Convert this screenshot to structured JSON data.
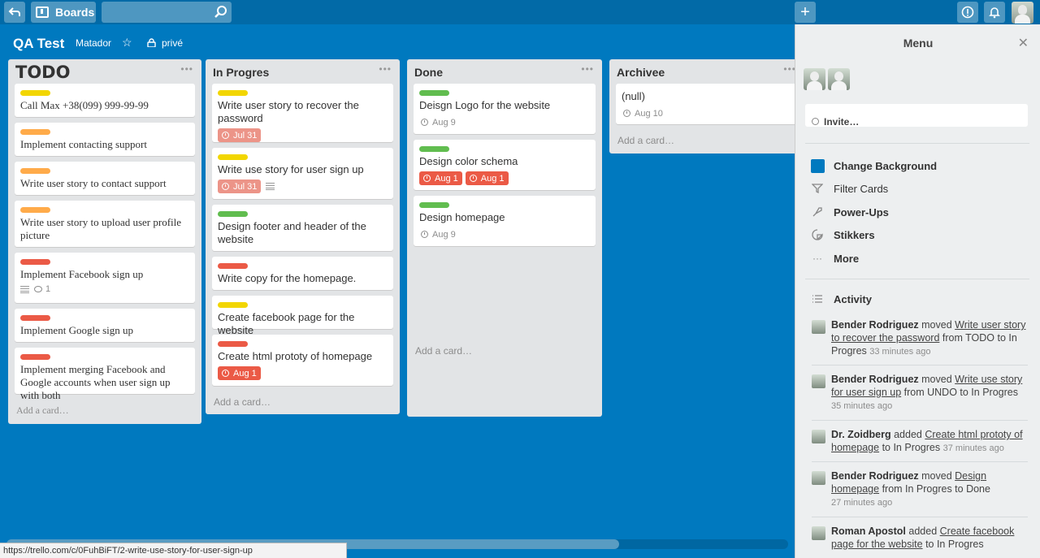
{
  "topbar": {
    "boards_label": "Boards",
    "search_placeholder": "",
    "plus": "+"
  },
  "board": {
    "title": "QA Test",
    "team": "Matador",
    "privacy": "privé"
  },
  "lists": [
    {
      "title": "TODO",
      "add_card": "Add a card…",
      "cards": [
        {
          "label_color": "#f2d600",
          "title": "Call Max +38(099) 999-99-99"
        },
        {
          "label_color": "#ffab4a",
          "title": "Implement contacting support"
        },
        {
          "label_color": "#ffab4a",
          "title": "Write user story to contact support"
        },
        {
          "label_color": "#ffab4a",
          "title": "Write user story to upload user profile picture"
        },
        {
          "label_color": "#eb5a46",
          "title": "Implement Facebook sign up",
          "comments": "1"
        },
        {
          "label_color": "#eb5a46",
          "title": "Implement Google sign up"
        },
        {
          "label_color": "#eb5a46",
          "title": "Implement merging Facebook and Google accounts when user sign up with both"
        }
      ]
    },
    {
      "title": "In Progres",
      "add_card": "Add a card…",
      "cards": [
        {
          "label_color": "#f2d600",
          "title": "Write user story to recover the password",
          "due": "Jul 31"
        },
        {
          "label_color": "#f2d600",
          "title": "Write use story for user sign up",
          "due": "Jul 31"
        },
        {
          "label_color": "#61bd4f",
          "title": "Design footer and header of the website"
        },
        {
          "label_color": "#eb5a46",
          "title": "Write copy for the homepage."
        },
        {
          "label_color": "#f2d600",
          "title": "Create facebook page for the website"
        },
        {
          "label_color": "#eb5a46",
          "title": "Create html prototy of homepage",
          "due": "Aug 1"
        }
      ]
    },
    {
      "title": "Done",
      "add_card": "Add a card…",
      "cards": [
        {
          "label_color": "#61bd4f",
          "title": "Deisgn Logo for the website",
          "due": "Aug 9"
        },
        {
          "label_color": "#61bd4f",
          "title": "Design color schema",
          "due": "Aug 1",
          "due2": "Aug 1"
        },
        {
          "label_color": "#61bd4f",
          "title": "Design homepage",
          "due": "Aug 9"
        }
      ]
    },
    {
      "title": "Archivee",
      "add_card": "Add a card…",
      "cards": [
        {
          "title": "(null)",
          "due": "Aug 10"
        }
      ]
    }
  ],
  "menu": {
    "title": "Menu",
    "invite": "Invite…",
    "items": [
      "Change Background",
      "Filter Cards",
      "Power-Ups",
      "Stikkers",
      "More"
    ],
    "activity_title": "Activity",
    "activity": [
      {
        "who": "Bender Rodriguez",
        "verb": "moved",
        "link": "Write user story to recover the password",
        "rest": "from TODO to In Progres",
        "when": "33 minutes ago"
      },
      {
        "who": "Bender Rodriguez",
        "verb": "moved",
        "link": "Write use story for user sign up",
        "rest": "from UNDO to In Progres",
        "when": "35 minutes ago"
      },
      {
        "who": "Dr. Zoidberg",
        "verb": "added",
        "link": "Create html prototy of homepage",
        "rest": "to In Progres",
        "when": "37 minutes ago"
      },
      {
        "who": "Bender Rodriguez",
        "verb": "moved",
        "link": "Design homepage",
        "rest": "from In Progres to Done",
        "when": "27 minutes ago"
      },
      {
        "who": "Roman Apostol",
        "verb": "added",
        "link": "Create facebook page for the website",
        "rest": "to In Progres",
        "when": ""
      }
    ]
  },
  "status_url": "https://trello.com/c/0FuhBiFT/2-write-use-story-for-user-sign-up",
  "colors": {
    "board_bg": "#0079bf",
    "topbar": "#026aa7",
    "red": "#eb5a46",
    "green": "#61bd4f",
    "yellow": "#f2d600",
    "orange": "#ffab4a"
  }
}
